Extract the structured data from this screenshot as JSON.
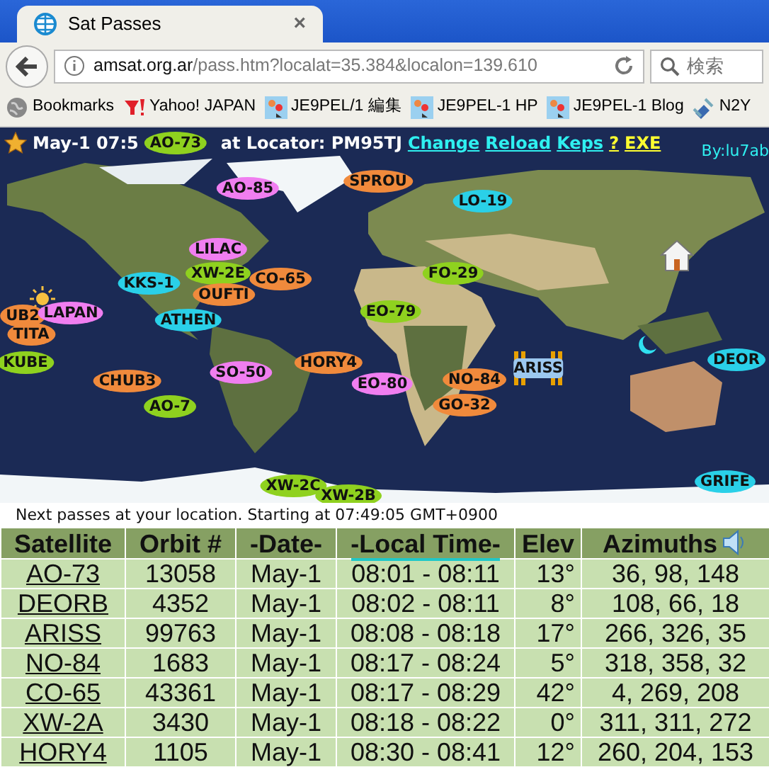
{
  "browser": {
    "tab": {
      "title": "Sat Passes",
      "close": "×"
    },
    "url": {
      "host": "amsat.org.ar",
      "path": "/pass.htm?localat=35.384&localon=139.610"
    },
    "search": {
      "placeholder": "検索"
    },
    "bookmarks": [
      {
        "label": "Bookmarks",
        "kind": "folder"
      },
      {
        "label": "Yahoo! JAPAN",
        "kind": "logo"
      },
      {
        "label": "JE9PEL/1 編集",
        "kind": "image"
      },
      {
        "label": "JE9PEL-1 HP",
        "kind": "image"
      },
      {
        "label": "JE9PEL-1 Blog",
        "kind": "image"
      },
      {
        "label": "N2Y",
        "kind": "satellite"
      }
    ]
  },
  "page": {
    "header": {
      "time": "May-1 07:5",
      "locator": "at Locator: PM95TJ",
      "links": [
        {
          "label": "Change",
          "kind": "nav"
        },
        {
          "label": "Reload",
          "kind": "nav"
        },
        {
          "label": "Keps",
          "kind": "nav"
        },
        {
          "label": "?",
          "kind": "help"
        },
        {
          "label": "EXE",
          "kind": "help"
        }
      ],
      "credit": "By:lu7ab"
    },
    "satellites": [
      {
        "label": "AO-73",
        "kind": "marker",
        "color": "#8fd11f"
      },
      {
        "label": "AO-85",
        "kind": "marker",
        "color": "#f07ef0"
      },
      {
        "label": "SPROU",
        "kind": "marker",
        "color": "#f08a3c"
      },
      {
        "label": "LO-19",
        "kind": "marker",
        "color": "#2ad0e8"
      },
      {
        "label": "LILAC",
        "kind": "marker",
        "color": "#f07ef0"
      },
      {
        "label": "KKS-1",
        "kind": "marker",
        "color": "#2ad0e8"
      },
      {
        "label": "XW-2E",
        "kind": "marker",
        "color": "#8fd11f"
      },
      {
        "label": "CO-65",
        "kind": "marker",
        "color": "#f08a3c"
      },
      {
        "label": "FO-29",
        "kind": "marker",
        "color": "#8fd11f"
      },
      {
        "label": "OUFTI",
        "kind": "marker",
        "color": "#f08a3c"
      },
      {
        "label": "UB2",
        "kind": "marker",
        "color": "#f08a3c"
      },
      {
        "label": "TITA",
        "kind": "marker",
        "color": "#f08a3c"
      },
      {
        "label": "LAPAN",
        "kind": "marker",
        "color": "#f07ef0"
      },
      {
        "label": "ATHEN",
        "kind": "marker",
        "color": "#2ad0e8"
      },
      {
        "label": "EO-79",
        "kind": "marker",
        "color": "#8fd11f"
      },
      {
        "label": "KUBE",
        "kind": "marker",
        "color": "#8fd11f"
      },
      {
        "label": "CHUB3",
        "kind": "marker",
        "color": "#f08a3c"
      },
      {
        "label": "SO-50",
        "kind": "marker",
        "color": "#f07ef0"
      },
      {
        "label": "HORY4",
        "kind": "marker",
        "color": "#f08a3c"
      },
      {
        "label": "EO-80",
        "kind": "marker",
        "color": "#f07ef0"
      },
      {
        "label": "NO-84",
        "kind": "marker",
        "color": "#f08a3c"
      },
      {
        "label": "ARISS",
        "kind": "station",
        "color": "#9cc8f0"
      },
      {
        "label": "DEOR",
        "kind": "marker",
        "color": "#2ad0e8"
      },
      {
        "label": "AO-7",
        "kind": "marker",
        "color": "#8fd11f"
      },
      {
        "label": "GO-32",
        "kind": "marker",
        "color": "#f08a3c"
      },
      {
        "label": "XW-2C",
        "kind": "marker",
        "color": "#8fd11f"
      },
      {
        "label": "XW-2B",
        "kind": "marker",
        "color": "#8fd11f"
      },
      {
        "label": "GRIFE",
        "kind": "marker",
        "color": "#2ad0e8"
      }
    ],
    "caption": "Next passes at your location. Starting at 07:49:05 GMT+0900",
    "table": {
      "columns": [
        {
          "label": "Satellite",
          "sorted": false
        },
        {
          "label": "Orbit #",
          "sorted": false
        },
        {
          "label": "-Date-",
          "sorted": false
        },
        {
          "label": "-Local Time-",
          "sorted": true
        },
        {
          "label": "Elev",
          "sorted": false
        },
        {
          "label": "Azimuths",
          "sorted": false
        }
      ],
      "rows": [
        [
          "AO-73",
          "13058",
          "May-1",
          "08:01 - 08:11",
          "13°",
          "36, 98, 148"
        ],
        [
          "DEORB",
          "4352",
          "May-1",
          "08:02 - 08:11",
          "8°",
          "108, 66, 18"
        ],
        [
          "ARISS",
          "99763",
          "May-1",
          "08:08 - 08:18",
          "17°",
          "266, 326, 35"
        ],
        [
          "NO-84",
          "1683",
          "May-1",
          "08:17 - 08:24",
          "5°",
          "318, 358, 32"
        ],
        [
          "CO-65",
          "43361",
          "May-1",
          "08:17 - 08:29",
          "42°",
          "4, 269, 208"
        ],
        [
          "XW-2A",
          "3430",
          "May-1",
          "08:18 - 08:22",
          "0°",
          "311, 311, 272"
        ],
        [
          "HORY4",
          "1105",
          "May-1",
          "08:30 - 08:41",
          "12°",
          "260, 204, 153"
        ]
      ]
    }
  }
}
